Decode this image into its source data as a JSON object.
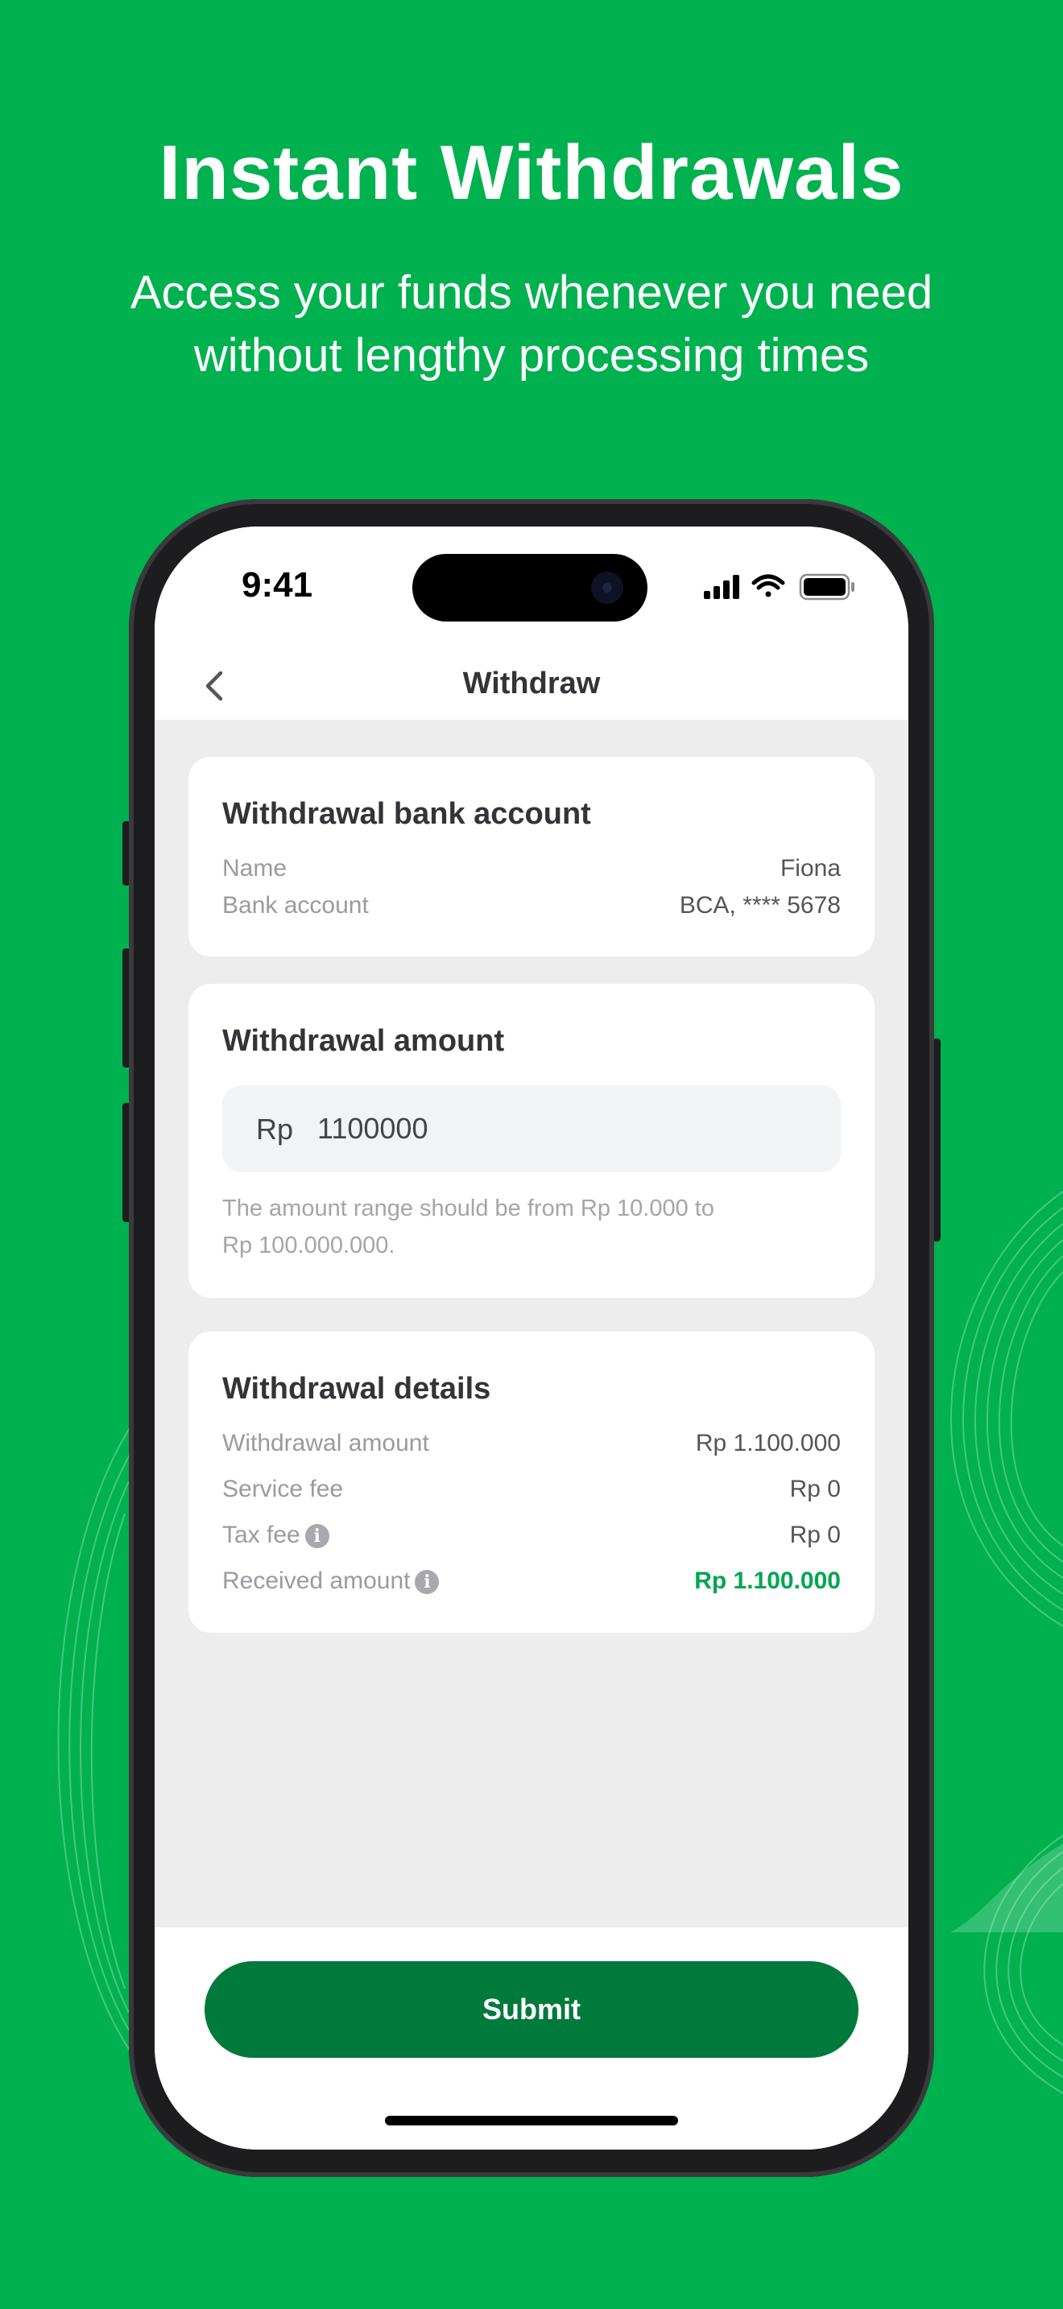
{
  "promo": {
    "headline": "Instant Withdrawals",
    "subline_1": "Access your funds whenever you need",
    "subline_2": "without lengthy processing times"
  },
  "status_bar": {
    "time": "9:41"
  },
  "nav": {
    "title": "Withdraw"
  },
  "bank_card": {
    "title": "Withdrawal bank account",
    "name_label": "Name",
    "name_value": "Fiona",
    "account_label": "Bank account",
    "account_value": "BCA, **** 5678"
  },
  "amount_card": {
    "title": "Withdrawal amount",
    "currency": "Rp",
    "amount_value": "1100000",
    "hint_1": "The amount range should be from Rp 10.000 to",
    "hint_2": "Rp 100.000.000."
  },
  "details_card": {
    "title": "Withdrawal details",
    "rows": [
      {
        "label": "Withdrawal amount",
        "value": "Rp 1.100.000"
      },
      {
        "label": "Service fee",
        "value": "Rp 0"
      },
      {
        "label": "Tax fee",
        "value": "Rp 0"
      },
      {
        "label": "Received amount",
        "value": "Rp 1.100.000"
      }
    ]
  },
  "actions": {
    "submit_label": "Submit"
  },
  "colors": {
    "background": "#00b14f",
    "primary_button": "#007a3a",
    "received_amount": "#00a651"
  }
}
